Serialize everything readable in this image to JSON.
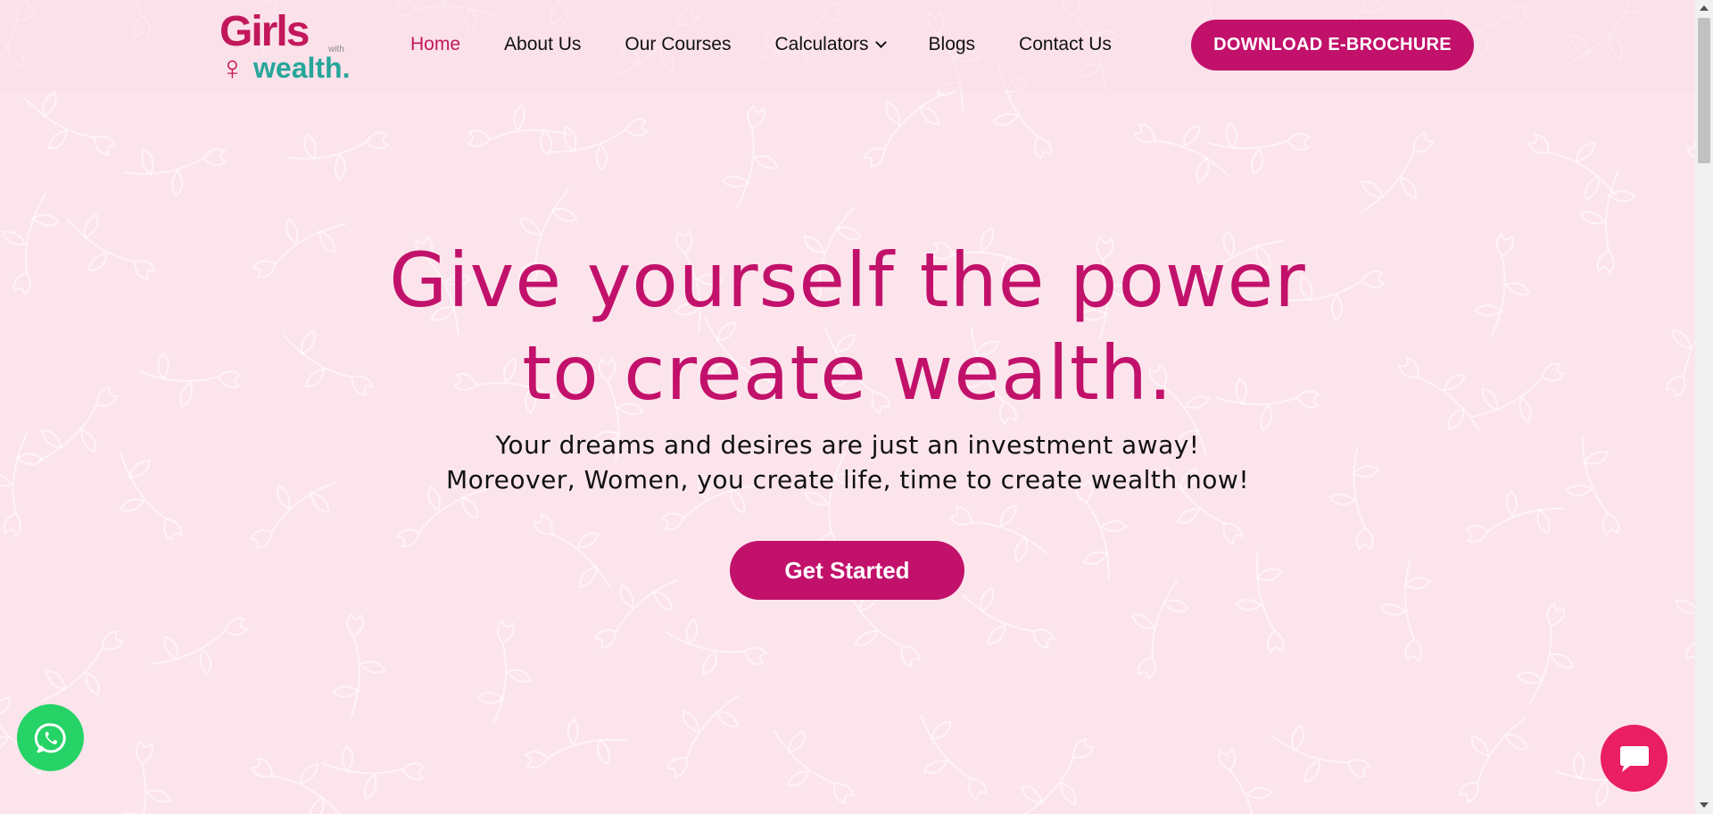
{
  "brand": {
    "logo_line1": "Girls",
    "logo_with": "with",
    "logo_line2": "wealth.",
    "primary_color": "#c2116b",
    "accent_color": "#26a69a"
  },
  "nav": {
    "items": [
      {
        "label": "Home",
        "active": true
      },
      {
        "label": "About Us"
      },
      {
        "label": "Our Courses"
      },
      {
        "label": "Calculators",
        "dropdown": true
      },
      {
        "label": "Blogs"
      },
      {
        "label": "Contact Us"
      }
    ],
    "cta": "DOWNLOAD E-BROCHURE"
  },
  "hero": {
    "headline_line1": "Give yourself the power",
    "headline_line2": "to create wealth.",
    "sub_line1": "Your dreams and desires are just an investment away!",
    "sub_line2": "Moreover, Women, you create life, time to create wealth now!",
    "button": "Get Started"
  },
  "widgets": {
    "whatsapp_icon": "whatsapp-icon",
    "chat_icon": "chat-bubble-icon",
    "whatsapp_color": "#25d366",
    "chat_color": "#e91e63"
  }
}
